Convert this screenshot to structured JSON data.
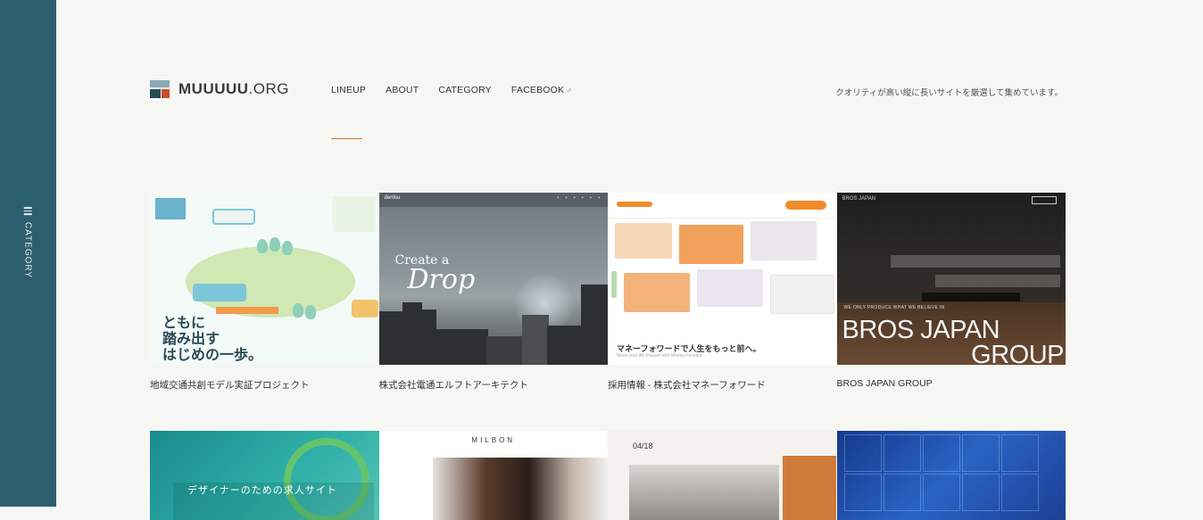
{
  "sidebar": {
    "label": "CATEGORY"
  },
  "logo": {
    "bold": "MUUUUU",
    "light": ".ORG"
  },
  "nav": {
    "items": [
      "LINEUP",
      "ABOUT",
      "CATEGORY",
      "FACEBOOK"
    ],
    "external_mark": "⇗"
  },
  "tagline": "クオリティが高い縦に長いサイトを厳選して集めています。",
  "cards": [
    {
      "title": "地域交通共創モデル実証プロジェクト",
      "thumb_text": [
        "ともに",
        "踏み出す",
        "はじめの一歩。"
      ]
    },
    {
      "title": "株式会社電通エルフトアーキテクト",
      "thumb_text": [
        "Create a",
        "Drop",
        "dentsu"
      ]
    },
    {
      "title": "採用情報 - 株式会社マネーフォワード",
      "thumb_text": [
        "マネーフォワードで人生をもっと前へ。",
        "Move your life forward with Money Forward"
      ]
    },
    {
      "title": "BROS JAPAN GROUP",
      "thumb_text": [
        "WE ONLY PRODUCE WHAT WE BELIEVE IN",
        "BROS JAPAN",
        "GROUP",
        "BROS JAPAN"
      ]
    },
    {
      "title": "",
      "thumb_text": [
        "デザイナーのための求人サイト"
      ]
    },
    {
      "title": "",
      "thumb_text": [
        "MILBON"
      ]
    },
    {
      "title": "",
      "thumb_text": [
        "04/18"
      ]
    },
    {
      "title": "",
      "thumb_text": []
    }
  ],
  "colors": {
    "rail": "#2b5e6e",
    "accent": "#c8762f",
    "background": "#f6f6f3"
  }
}
